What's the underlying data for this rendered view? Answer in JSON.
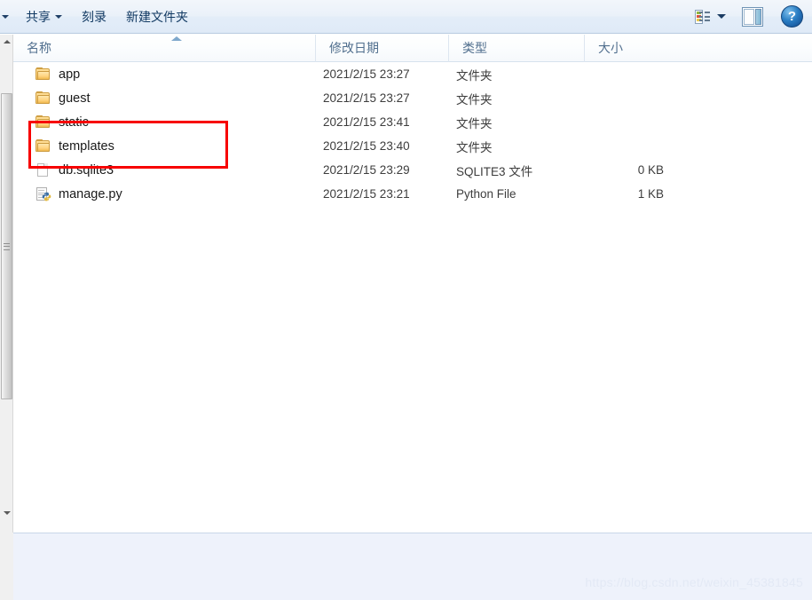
{
  "toolbar": {
    "organize_caret_icon": "chevron-down-icon",
    "items": [
      {
        "label": "共享",
        "has_caret": true
      },
      {
        "label": "刻录",
        "has_caret": false
      },
      {
        "label": "新建文件夹",
        "has_caret": false
      }
    ],
    "view_icon": "details-view-icon",
    "view_caret_icon": "chevron-down-icon",
    "preview_pane_icon": "preview-pane-icon",
    "help_icon": "help-question-icon",
    "help_label": "?"
  },
  "columns": {
    "name": "名称",
    "date": "修改日期",
    "type": "类型",
    "size": "大小",
    "sort_indicator": "sort-ascending-icon"
  },
  "files": [
    {
      "name": "app",
      "date": "2021/2/15 23:27",
      "type": "文件夹",
      "size": "",
      "icon": "folder-icon"
    },
    {
      "name": "guest",
      "date": "2021/2/15 23:27",
      "type": "文件夹",
      "size": "",
      "icon": "folder-icon"
    },
    {
      "name": "static",
      "date": "2021/2/15 23:41",
      "type": "文件夹",
      "size": "",
      "icon": "folder-icon"
    },
    {
      "name": "templates",
      "date": "2021/2/15 23:40",
      "type": "文件夹",
      "size": "",
      "icon": "folder-icon"
    },
    {
      "name": "db.sqlite3",
      "date": "2021/2/15 23:29",
      "type": "SQLITE3 文件",
      "size": "0 KB",
      "icon": "document-icon"
    },
    {
      "name": "manage.py",
      "date": "2021/2/15 23:21",
      "type": "Python File",
      "size": "1 KB",
      "icon": "python-file-icon"
    }
  ],
  "annotation": {
    "color": "#f70000",
    "covers": [
      "static",
      "templates"
    ]
  },
  "scrollbar": {
    "up_arrow_icon": "scroll-up-arrow-icon",
    "down_arrow_icon": "scroll-down-arrow-icon"
  },
  "watermark": {
    "text": "https://blog.csdn.net/weixin_45381845"
  }
}
